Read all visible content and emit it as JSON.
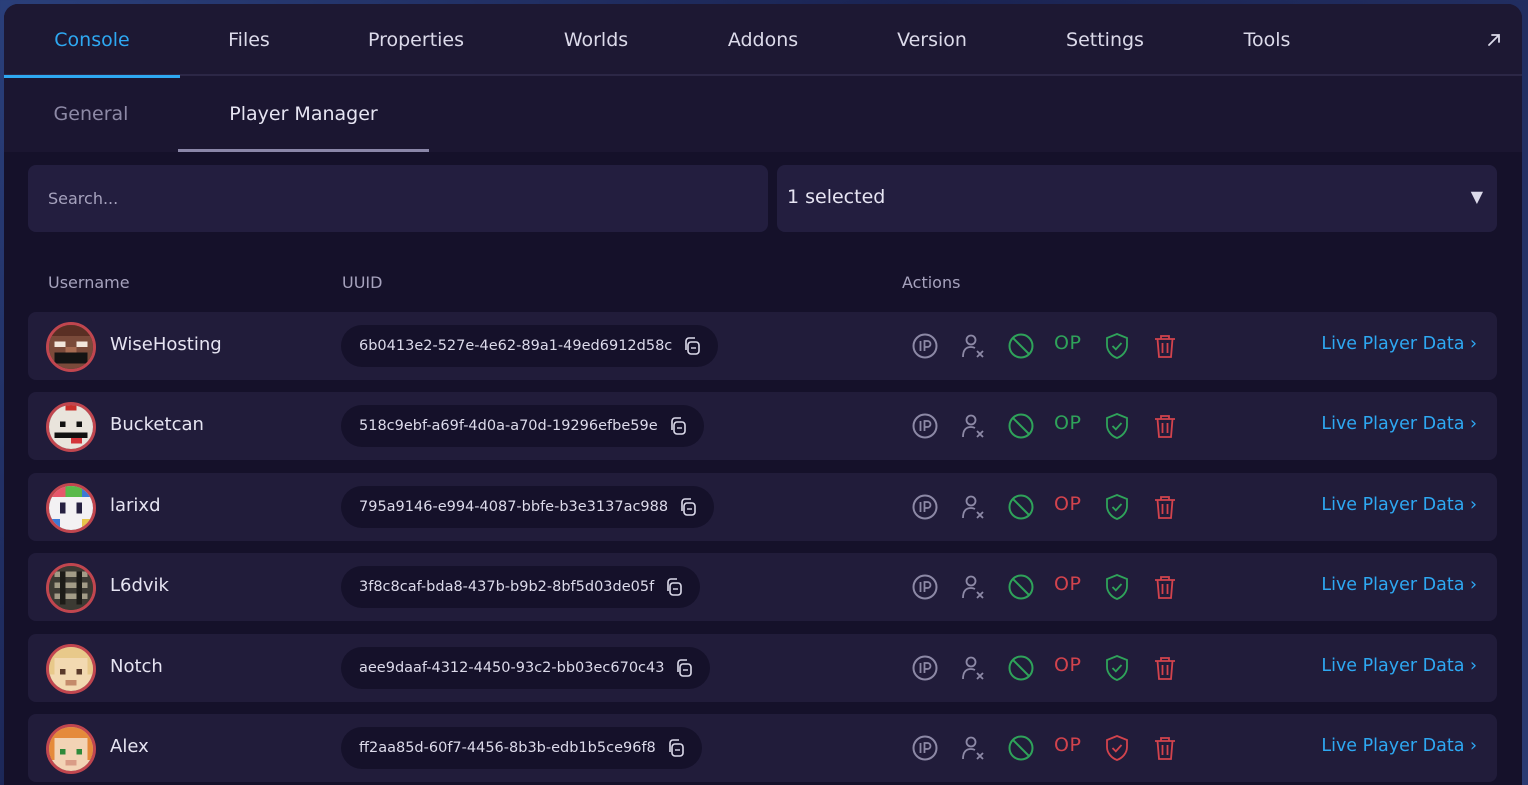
{
  "top_tabs": [
    {
      "label": "Console",
      "active": true
    },
    {
      "label": "Files",
      "active": false
    },
    {
      "label": "Properties",
      "active": false
    },
    {
      "label": "Worlds",
      "active": false
    },
    {
      "label": "Addons",
      "active": false
    },
    {
      "label": "Version",
      "active": false
    },
    {
      "label": "Settings",
      "active": false
    },
    {
      "label": "Tools",
      "active": false
    }
  ],
  "sub_tabs": [
    {
      "label": "General",
      "active": false
    },
    {
      "label": "Player Manager",
      "active": true
    }
  ],
  "search": {
    "placeholder": "Search...",
    "value": ""
  },
  "filter": {
    "value": "1 selected",
    "arrow": "▼"
  },
  "columns": {
    "username": "Username",
    "uuid": "UUID",
    "actions": "Actions"
  },
  "live_link_label": "Live Player Data ›",
  "op_label": "OP",
  "colors": {
    "accent": "#2ea8f2",
    "op_on": "#2fa35a",
    "op_off": "#d2434d",
    "shield_on": "#2fa35a",
    "shield_off": "#d2434d",
    "ban": "#2fa35a",
    "delete": "#d2434d",
    "neutral_icon": "#8d89a6"
  },
  "players": [
    {
      "username": "WiseHosting",
      "uuid": "6b0413e2-527e-4e62-89a1-49ed6912d58c",
      "op": true,
      "whitelisted": true,
      "avatar": "wisehosting-skin"
    },
    {
      "username": "Bucketcan",
      "uuid": "518c9ebf-a69f-4d0a-a70d-19296efbe59e",
      "op": true,
      "whitelisted": true,
      "avatar": "bucketcan-skin"
    },
    {
      "username": "larixd",
      "uuid": "795a9146-e994-4087-bbfe-b3e3137ac988",
      "op": false,
      "whitelisted": true,
      "avatar": "larixd-skin"
    },
    {
      "username": "L6dvik",
      "uuid": "3f8c8caf-bda8-437b-b9b2-8bf5d03de05f",
      "op": false,
      "whitelisted": true,
      "avatar": "l6dvik-skin"
    },
    {
      "username": "Notch",
      "uuid": "aee9daaf-4312-4450-93c2-bb03ec670c43",
      "op": false,
      "whitelisted": true,
      "avatar": "notch-skin"
    },
    {
      "username": "Alex",
      "uuid": "ff2aa85d-60f7-4456-8b3b-edb1b5ce96f8",
      "op": false,
      "whitelisted": false,
      "avatar": "alex-skin"
    }
  ]
}
